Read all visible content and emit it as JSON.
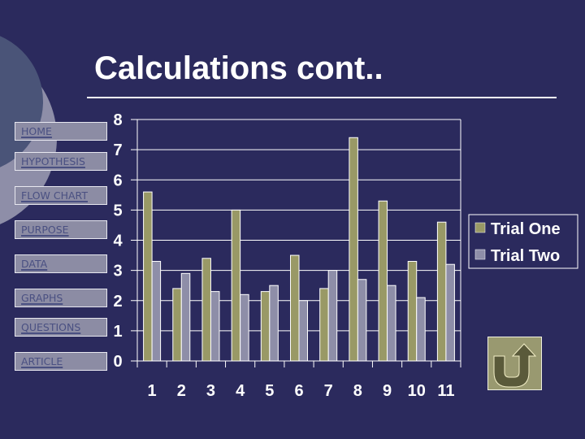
{
  "slide": {
    "title": "Calculations cont..",
    "background_color": "#2b2a5d"
  },
  "nav": {
    "items": [
      {
        "label": "HOME"
      },
      {
        "label": "HYPOTHESIS"
      },
      {
        "label": "FLOW CHART"
      },
      {
        "label": "PURPOSE"
      },
      {
        "label": "DATA"
      },
      {
        "label": "GRAPHS"
      },
      {
        "label": "QUESTIONS"
      },
      {
        "label": "ARTICLE"
      }
    ]
  },
  "return_button": {
    "icon": "u-turn-return-arrow-icon",
    "label": "Return"
  },
  "chart_data": {
    "type": "bar",
    "title": "",
    "xlabel": "",
    "ylabel": "",
    "categories": [
      "1",
      "2",
      "3",
      "4",
      "5",
      "6",
      "7",
      "8",
      "9",
      "10",
      "11"
    ],
    "series": [
      {
        "name": "Trial One",
        "color": "#999966",
        "values": [
          5.6,
          2.4,
          3.4,
          5.0,
          2.3,
          3.5,
          2.4,
          7.4,
          5.3,
          3.3,
          4.6
        ]
      },
      {
        "name": "Trial Two",
        "color": "#8e8ea8",
        "values": [
          3.3,
          2.9,
          2.3,
          2.2,
          2.5,
          2.0,
          3.0,
          2.7,
          2.5,
          2.1,
          3.2
        ]
      }
    ],
    "ylim": [
      0,
      8
    ],
    "yticks": [
      "0",
      "1",
      "2",
      "3",
      "4",
      "5",
      "6",
      "7",
      "8"
    ],
    "grid": true,
    "legend": "right"
  }
}
